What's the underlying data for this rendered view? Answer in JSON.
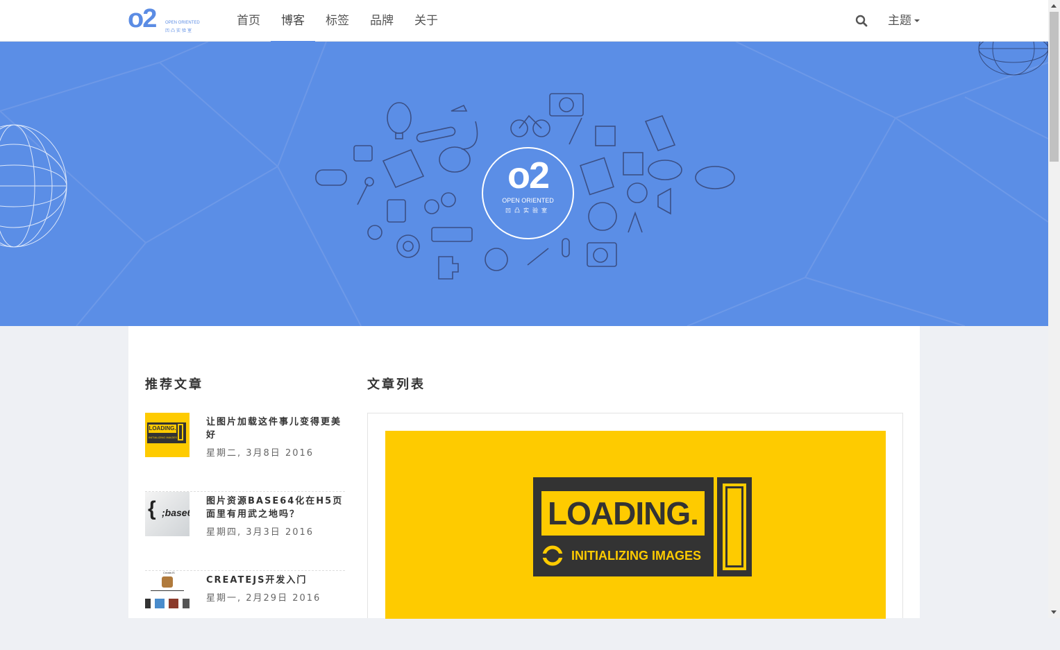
{
  "logo": {
    "mark": "o2",
    "line1": "OPEN ORIENTED",
    "line2": "凹凸实验室"
  },
  "nav": {
    "items": [
      {
        "label": "首页"
      },
      {
        "label": "博客"
      },
      {
        "label": "标签"
      },
      {
        "label": "品牌"
      },
      {
        "label": "关于"
      }
    ],
    "active_index": 1,
    "theme_label": "主题"
  },
  "hero": {
    "logo_mark": "o2",
    "logo_en": "OPEN ORIENTED",
    "logo_cn": "凹凸实验室"
  },
  "sidebar": {
    "title": "推荐文章",
    "articles": [
      {
        "title": "让图片加载这件事儿变得更美好",
        "date": "星期二, 3月8日 2016",
        "thumb": "loading-yellow"
      },
      {
        "title": "图片资源BASE64化在H5页面里有用武之地吗？",
        "date": "星期四, 3月3日 2016",
        "thumb": "base64"
      },
      {
        "title": "CREATEJS开发入门",
        "date": "星期一, 2月29日 2016",
        "thumb": "createjs"
      }
    ]
  },
  "main": {
    "title": "文章列表",
    "banner": {
      "loading_text": "LOADING.",
      "sub_text": "INITIALIZING IMAGES"
    }
  },
  "thumb_texts": {
    "loading": "LOADING.",
    "initializing": "INITIALIZING IMAGES",
    "base64": ";base6",
    "createjs": "CreateJS"
  },
  "colors": {
    "accent": "#5b8ce4",
    "hero_bg": "#5b8ee6",
    "banner_yellow": "#fecb00",
    "banner_dark": "#333333"
  }
}
